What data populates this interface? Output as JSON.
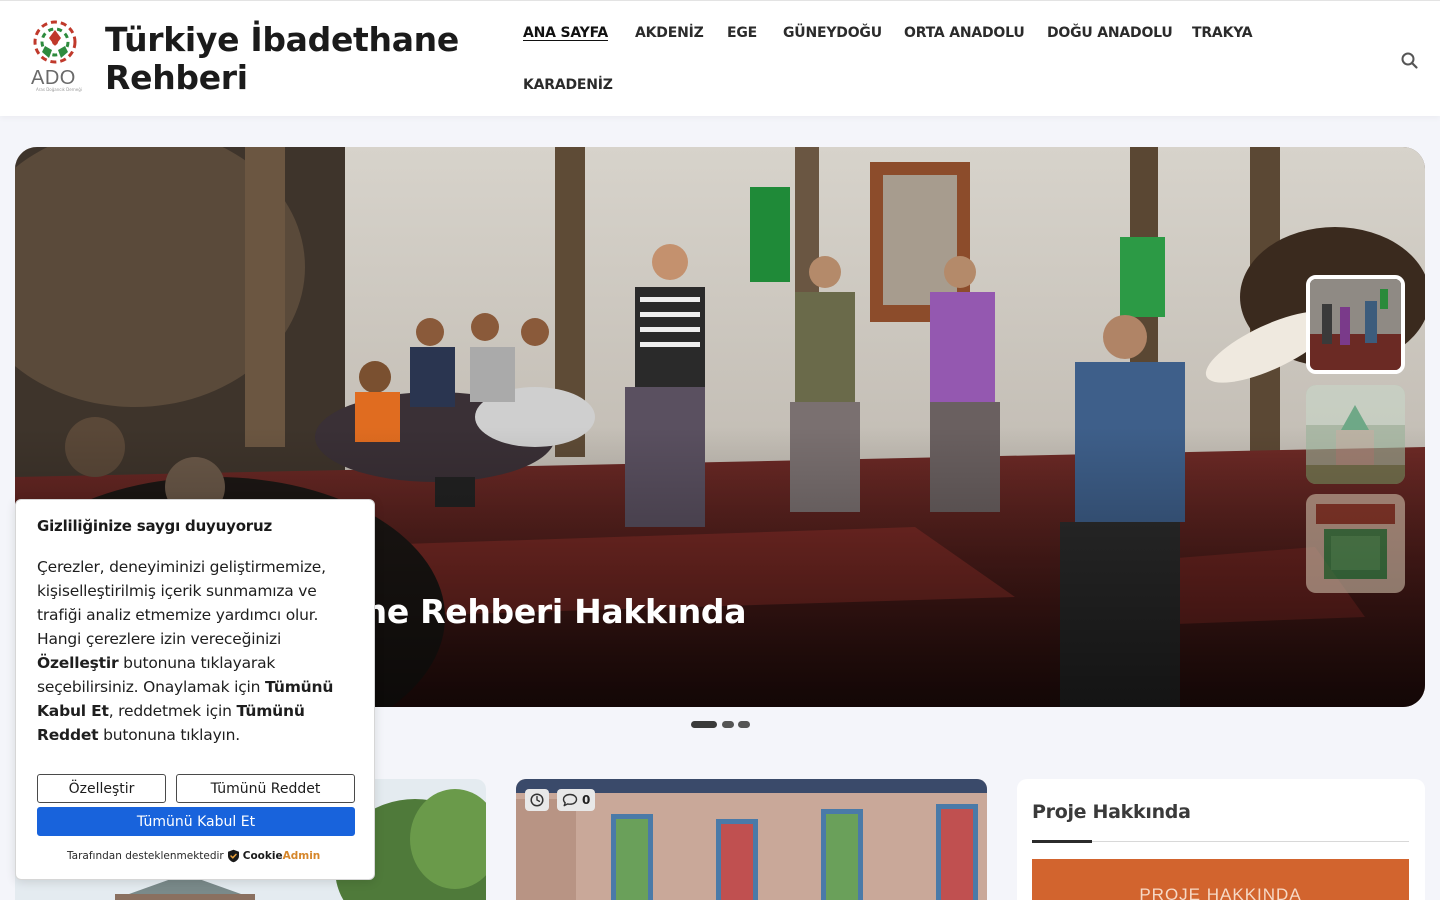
{
  "header": {
    "logo_text": "ADO",
    "logo_subtext": "Aras Doğancık Derneği",
    "site_title": "Türkiye İbadethane Rehberi",
    "nav": [
      {
        "label": "ANA SAYFA",
        "active": true
      },
      {
        "label": "AKDENİZ"
      },
      {
        "label": "EGE"
      },
      {
        "label": "GÜNEYDOĞU"
      },
      {
        "label": "ORTA ANADOLU"
      },
      {
        "label": "DOĞU ANADOLU"
      },
      {
        "label": "TRAKYA"
      },
      {
        "label": "KARADENİZ"
      }
    ],
    "search_icon": "search-icon"
  },
  "hero": {
    "title": "Türkiye İbadethane Rehberi Hakkında",
    "thumbnails": [
      {
        "name": "ceremony-interior",
        "active": true
      },
      {
        "name": "green-dome-tomb",
        "active": false
      },
      {
        "name": "green-tomb-interior",
        "active": false
      }
    ],
    "dots_count": 3,
    "active_dot": 0
  },
  "cards": [
    {
      "name": "mosque-card-left"
    },
    {
      "name": "mosque-card-interior",
      "comment_count": "0",
      "icons": [
        "clock-icon",
        "comment-icon"
      ]
    }
  ],
  "sidebar": {
    "widget_title": "Proje Hakkında",
    "button_label": "PROJE HAKKINDA"
  },
  "cookie_consent": {
    "title": "Gizliliğinize saygı duyuyoruz",
    "body_p1": "Çerezler, deneyiminizi geliştirmemize, kişiselleştirilmiş içerik sunmamıza ve trafiği analiz etmemize yardımcı olur. Hangi çerezlere izin vereceğinizi ",
    "body_b1": "Özelleştir",
    "body_p2": " butonuna tıklayarak seçebilirsiniz. Onaylamak için ",
    "body_b2": "Tümünü Kabul Et",
    "body_p3": ", reddetmek için ",
    "body_b3": "Tümünü Reddet",
    "body_p4": " butonuna tıklayın.",
    "customize_label": "Özelleştir",
    "reject_label": "Tümünü Reddet",
    "accept_label": "Tümünü Kabul Et",
    "powered_by": "Tarafından desteklenmektedir",
    "brand_part1": "Cookie",
    "brand_part2": "Admin",
    "accept_color": "#1863dc"
  },
  "colors": {
    "accent_orange": "#d2642e",
    "page_bg": "#f4f5fa"
  }
}
